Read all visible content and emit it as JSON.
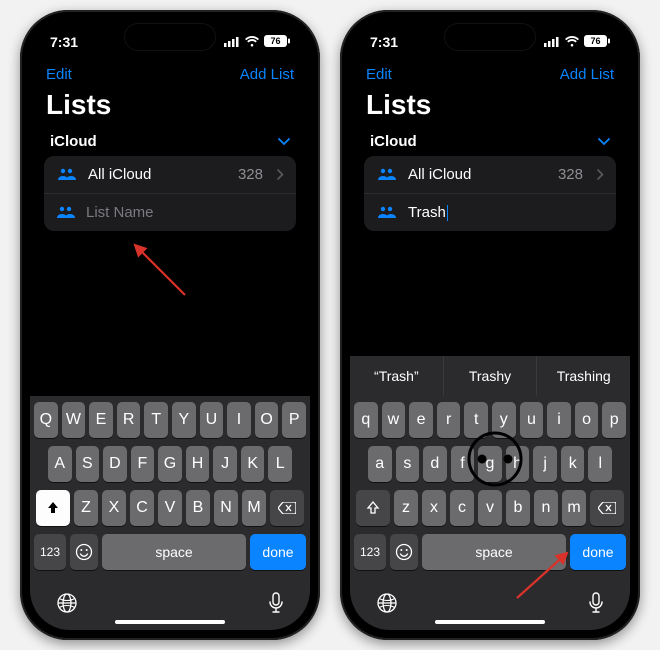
{
  "status": {
    "time": "7:31",
    "battery_label": "76"
  },
  "nav": {
    "left": "Edit",
    "right": "Add List"
  },
  "title": "Lists",
  "section": {
    "header": "iCloud"
  },
  "rows": {
    "all": {
      "label": "All iCloud",
      "count": "328"
    }
  },
  "left": {
    "input_placeholder": "List Name",
    "input_value": ""
  },
  "right": {
    "input_value": "Trash",
    "suggestions": [
      "“Trash”",
      "Trashy",
      "Trashing"
    ]
  },
  "kbd": {
    "row1_upper": [
      "Q",
      "W",
      "E",
      "R",
      "T",
      "Y",
      "U",
      "I",
      "O",
      "P"
    ],
    "row2_upper": [
      "A",
      "S",
      "D",
      "F",
      "G",
      "H",
      "J",
      "K",
      "L"
    ],
    "row3_upper": [
      "Z",
      "X",
      "C",
      "V",
      "B",
      "N",
      "M"
    ],
    "row1_lower": [
      "q",
      "w",
      "e",
      "r",
      "t",
      "y",
      "u",
      "i",
      "o",
      "p"
    ],
    "row2_lower": [
      "a",
      "s",
      "d",
      "f",
      "g",
      "h",
      "j",
      "k",
      "l"
    ],
    "row3_lower": [
      "z",
      "x",
      "c",
      "v",
      "b",
      "n",
      "m"
    ],
    "n123": "123",
    "space": "space",
    "done": "done"
  }
}
